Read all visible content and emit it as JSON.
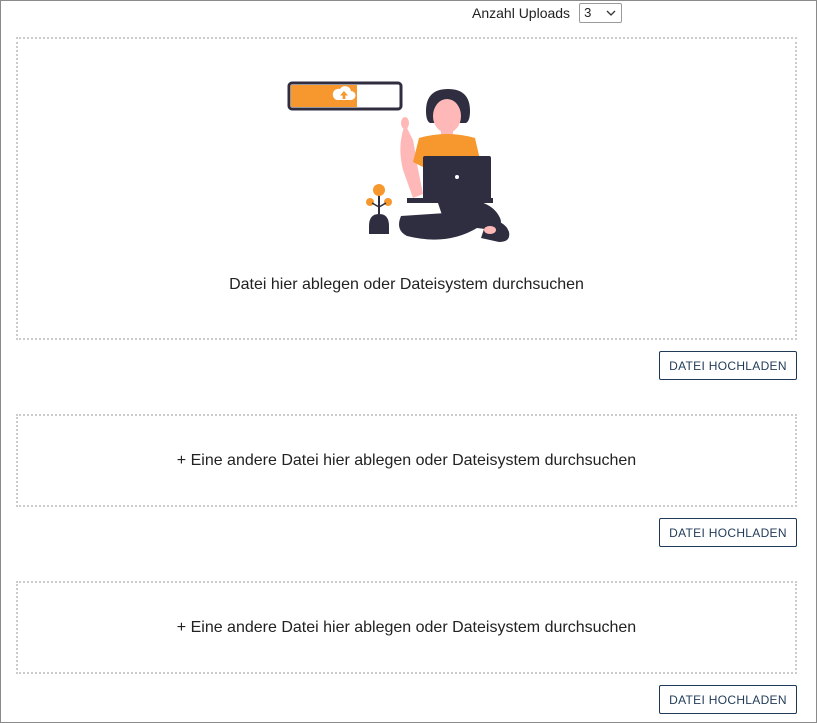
{
  "uploads_count": {
    "label": "Anzahl Uploads",
    "selected": "3"
  },
  "dropzones": [
    {
      "text": "Datei hier ablegen oder Dateisystem durchsuchen",
      "illustration": "person-with-laptop-upload-illustration",
      "button_label": "DATEI HOCHLADEN"
    },
    {
      "text": "+ Eine andere Datei hier ablegen oder Dateisystem durchsuchen",
      "button_label": "DATEI HOCHLADEN"
    },
    {
      "text": "+ Eine andere Datei hier ablegen oder Dateisystem durchsuchen",
      "button_label": "DATEI HOCHLADEN"
    }
  ],
  "colors": {
    "accent_orange": "#f7982f",
    "dark_navy": "#2f2e41",
    "button_border": "#1f3a57",
    "dropzone_border": "#cccccc"
  }
}
